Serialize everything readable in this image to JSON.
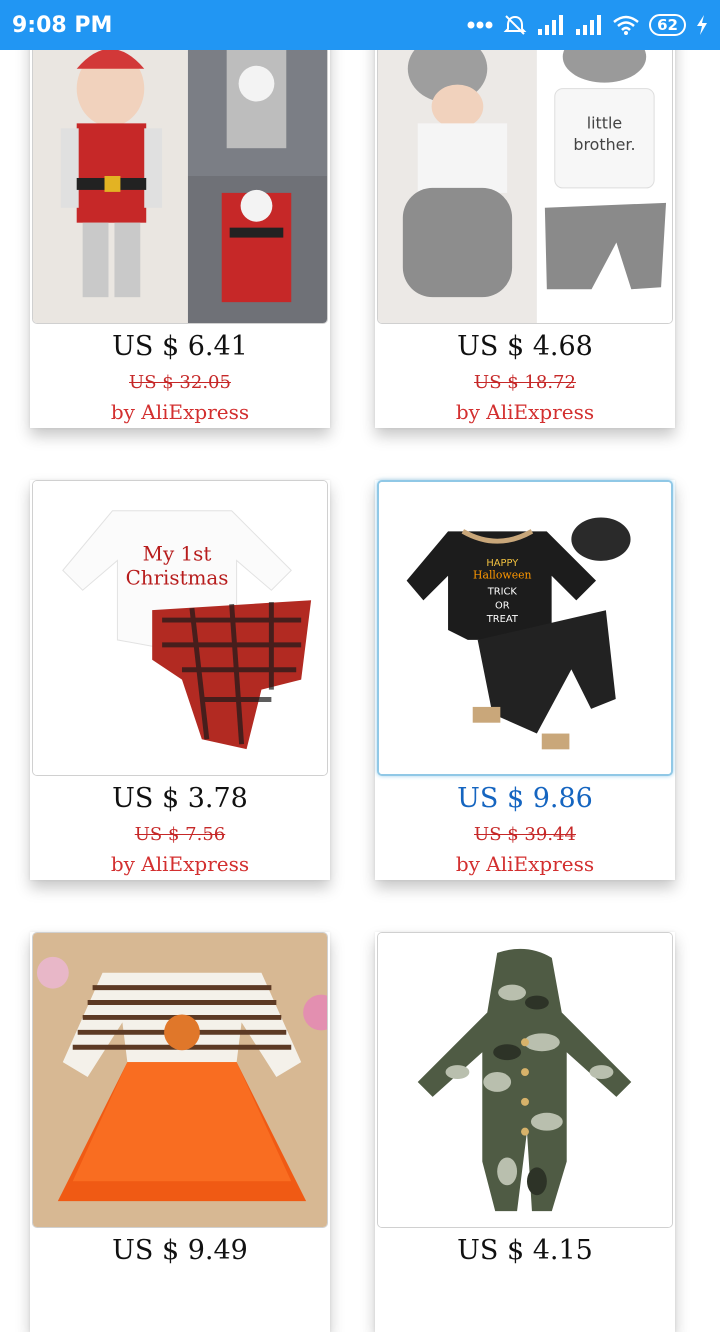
{
  "status_bar": {
    "time": "9:08 PM",
    "battery": "62",
    "icons": [
      "more-dots-icon",
      "alarm-off-icon",
      "signal-icon",
      "signal-icon",
      "wifi-icon",
      "battery-icon",
      "charging-icon"
    ]
  },
  "colors": {
    "status_bar": "#2196f3",
    "price": "#111111",
    "price_active": "#1565c0",
    "old_price": "#c62828",
    "seller": "#d32f2f"
  },
  "products": [
    {
      "price": "US $ 6.41",
      "old_price": "US $ 32.05",
      "seller": "by AliExpress",
      "image": "santa-baby-romper"
    },
    {
      "price": "US $ 4.68",
      "old_price": "US $ 18.72",
      "seller": "by AliExpress",
      "image": "little-brother-outfit"
    },
    {
      "price": "US $ 3.78",
      "old_price": "US $ 7.56",
      "seller": "by AliExpress",
      "image": "my-1st-christmas-outfit"
    },
    {
      "price": "US $ 9.86",
      "old_price": "US $ 39.44",
      "seller": "by AliExpress",
      "image": "halloween-outfit"
    },
    {
      "price": "US $ 9.49",
      "old_price": "",
      "seller": "",
      "image": "turkey-tutu-dress"
    },
    {
      "price": "US $ 4.15",
      "old_price": "",
      "seller": "",
      "image": "camo-hooded-romper"
    }
  ]
}
